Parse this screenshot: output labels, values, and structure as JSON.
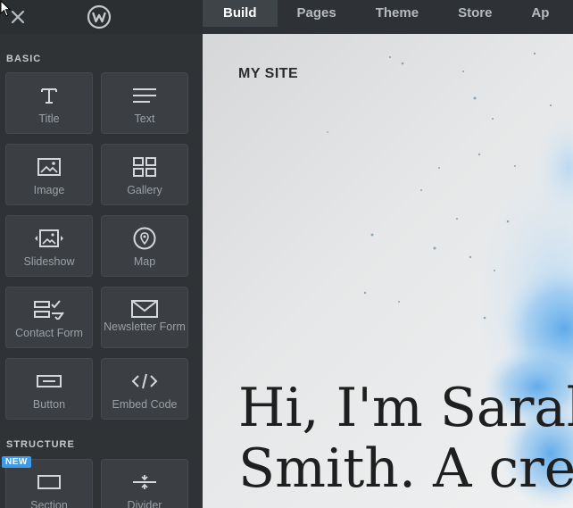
{
  "topbar": {
    "close_icon": "close-icon",
    "logo_icon": "weebly-logo-icon",
    "tabs": [
      {
        "label": "Build",
        "active": true
      },
      {
        "label": "Pages",
        "active": false
      },
      {
        "label": "Theme",
        "active": false
      },
      {
        "label": "Store",
        "active": false
      },
      {
        "label": "Ap",
        "active": false
      }
    ]
  },
  "sidebar": {
    "basic_label": "BASIC",
    "structure_label": "STRUCTURE",
    "new_badge": "NEW",
    "basic_items": [
      {
        "label": "Title",
        "icon": "title-icon"
      },
      {
        "label": "Text",
        "icon": "text-icon"
      },
      {
        "label": "Image",
        "icon": "image-icon"
      },
      {
        "label": "Gallery",
        "icon": "gallery-icon"
      },
      {
        "label": "Slideshow",
        "icon": "slideshow-icon"
      },
      {
        "label": "Map",
        "icon": "map-pin-icon"
      },
      {
        "label": "Contact Form",
        "icon": "contact-form-icon"
      },
      {
        "label": "Newsletter Form",
        "icon": "envelope-icon"
      },
      {
        "label": "Button",
        "icon": "button-icon"
      },
      {
        "label": "Embed Code",
        "icon": "code-icon"
      }
    ],
    "structure_items": [
      {
        "label": "Section",
        "icon": "section-icon"
      },
      {
        "label": "Divider",
        "icon": "divider-icon"
      }
    ]
  },
  "canvas": {
    "site_title": "MY SITE",
    "hero_line1": "Hi, I'm Sarah",
    "hero_line2": "Smith. A cre"
  },
  "colors": {
    "topbar_bg": "#2e3236",
    "sidebar_bg": "#2f3336",
    "tile_bg": "#3b3f43",
    "active_tab_bg": "#3f4448",
    "new_badge": "#3d9be9"
  }
}
